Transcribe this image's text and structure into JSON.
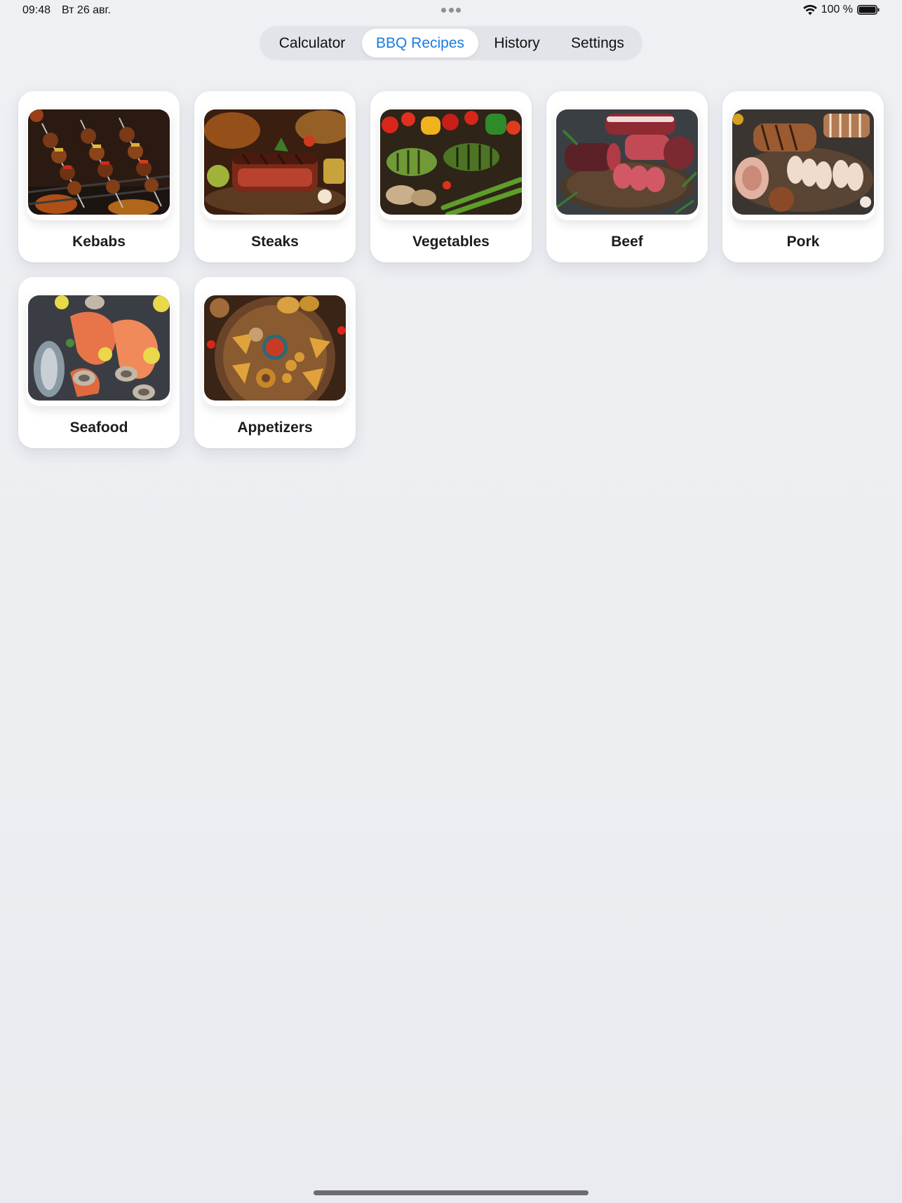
{
  "status_bar": {
    "time": "09:48",
    "date": "Вт 26 авг.",
    "battery_percent": "100 %",
    "icons": [
      "wifi-icon",
      "battery-icon"
    ]
  },
  "tabs": [
    {
      "label": "Calculator",
      "selected": false
    },
    {
      "label": "BBQ Recipes",
      "selected": true
    },
    {
      "label": "History",
      "selected": false
    },
    {
      "label": "Settings",
      "selected": false
    }
  ],
  "accent_color": "#1a7ce0",
  "categories": [
    {
      "label": "Kebabs",
      "image": "kebabs-photo"
    },
    {
      "label": "Steaks",
      "image": "steaks-photo"
    },
    {
      "label": "Vegetables",
      "image": "vegetables-photo"
    },
    {
      "label": "Beef",
      "image": "beef-photo"
    },
    {
      "label": "Pork",
      "image": "pork-photo"
    },
    {
      "label": "Seafood",
      "image": "seafood-photo"
    },
    {
      "label": "Appetizers",
      "image": "appetizers-photo"
    }
  ]
}
